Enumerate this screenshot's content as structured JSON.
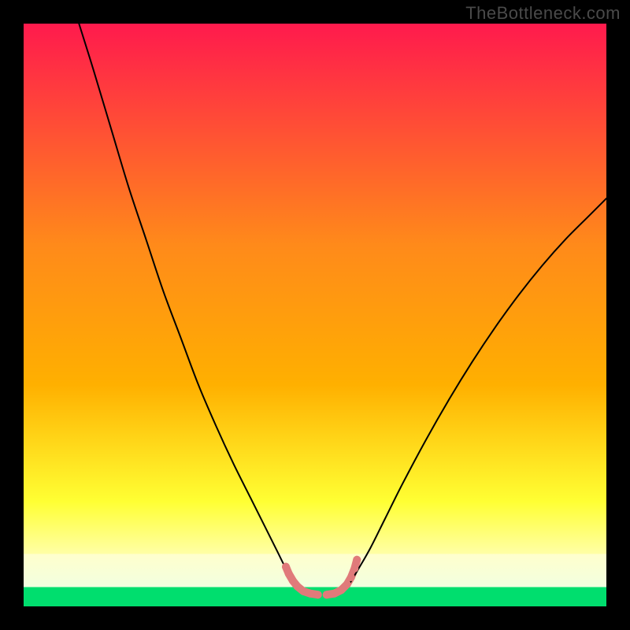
{
  "watermark": "TheBottleneck.com",
  "chart_data": {
    "type": "line",
    "title": "",
    "xlabel": "",
    "ylabel": "",
    "xlim": [
      0,
      100
    ],
    "ylim": [
      0,
      100
    ],
    "background_gradient": {
      "top": "#ff1a4d",
      "mid1": "#ffb000",
      "mid2": "#ffff33",
      "mid3": "#ffff99",
      "bottom": "#00e673"
    },
    "series": [
      {
        "name": "curve-left",
        "stroke": "#000000",
        "stroke_width": 2,
        "points": [
          {
            "x": 9.5,
            "y": 100.0
          },
          {
            "x": 12.0,
            "y": 92.0
          },
          {
            "x": 15.0,
            "y": 82.0
          },
          {
            "x": 18.0,
            "y": 72.0
          },
          {
            "x": 21.0,
            "y": 63.0
          },
          {
            "x": 24.0,
            "y": 54.0
          },
          {
            "x": 27.0,
            "y": 46.0
          },
          {
            "x": 30.0,
            "y": 38.0
          },
          {
            "x": 33.0,
            "y": 31.0
          },
          {
            "x": 36.0,
            "y": 24.5
          },
          {
            "x": 39.0,
            "y": 18.5
          },
          {
            "x": 41.5,
            "y": 13.5
          },
          {
            "x": 43.5,
            "y": 9.5
          },
          {
            "x": 45.0,
            "y": 6.5
          },
          {
            "x": 46.5,
            "y": 4.0
          }
        ]
      },
      {
        "name": "curve-right",
        "stroke": "#000000",
        "stroke_width": 2,
        "points": [
          {
            "x": 56.0,
            "y": 4.0
          },
          {
            "x": 57.5,
            "y": 6.5
          },
          {
            "x": 59.5,
            "y": 10.0
          },
          {
            "x": 62.0,
            "y": 15.0
          },
          {
            "x": 65.0,
            "y": 21.0
          },
          {
            "x": 69.0,
            "y": 28.5
          },
          {
            "x": 73.0,
            "y": 35.5
          },
          {
            "x": 77.0,
            "y": 42.0
          },
          {
            "x": 81.0,
            "y": 48.0
          },
          {
            "x": 85.0,
            "y": 53.5
          },
          {
            "x": 89.0,
            "y": 58.5
          },
          {
            "x": 93.0,
            "y": 63.0
          },
          {
            "x": 97.0,
            "y": 67.0
          },
          {
            "x": 100.0,
            "y": 70.0
          }
        ]
      },
      {
        "name": "highlight-dots-left",
        "stroke": "#e07a7a",
        "stroke_width": 10,
        "linecap": "round",
        "points": [
          {
            "x": 45.0,
            "y": 6.8
          },
          {
            "x": 45.5,
            "y": 5.6
          },
          {
            "x": 46.2,
            "y": 4.4
          },
          {
            "x": 47.0,
            "y": 3.4
          },
          {
            "x": 48.0,
            "y": 2.6
          },
          {
            "x": 49.2,
            "y": 2.2
          },
          {
            "x": 50.5,
            "y": 2.0
          }
        ]
      },
      {
        "name": "highlight-dots-right",
        "stroke": "#e07a7a",
        "stroke_width": 10,
        "linecap": "round",
        "points": [
          {
            "x": 52.0,
            "y": 2.0
          },
          {
            "x": 53.3,
            "y": 2.2
          },
          {
            "x": 54.5,
            "y": 2.8
          },
          {
            "x": 55.5,
            "y": 3.8
          },
          {
            "x": 56.2,
            "y": 5.0
          },
          {
            "x": 56.8,
            "y": 6.5
          },
          {
            "x": 57.2,
            "y": 8.0
          }
        ]
      }
    ],
    "green_band": {
      "y0": 0.0,
      "y1": 3.3
    },
    "pale_band": {
      "y0": 3.3,
      "y1": 9.0
    }
  }
}
